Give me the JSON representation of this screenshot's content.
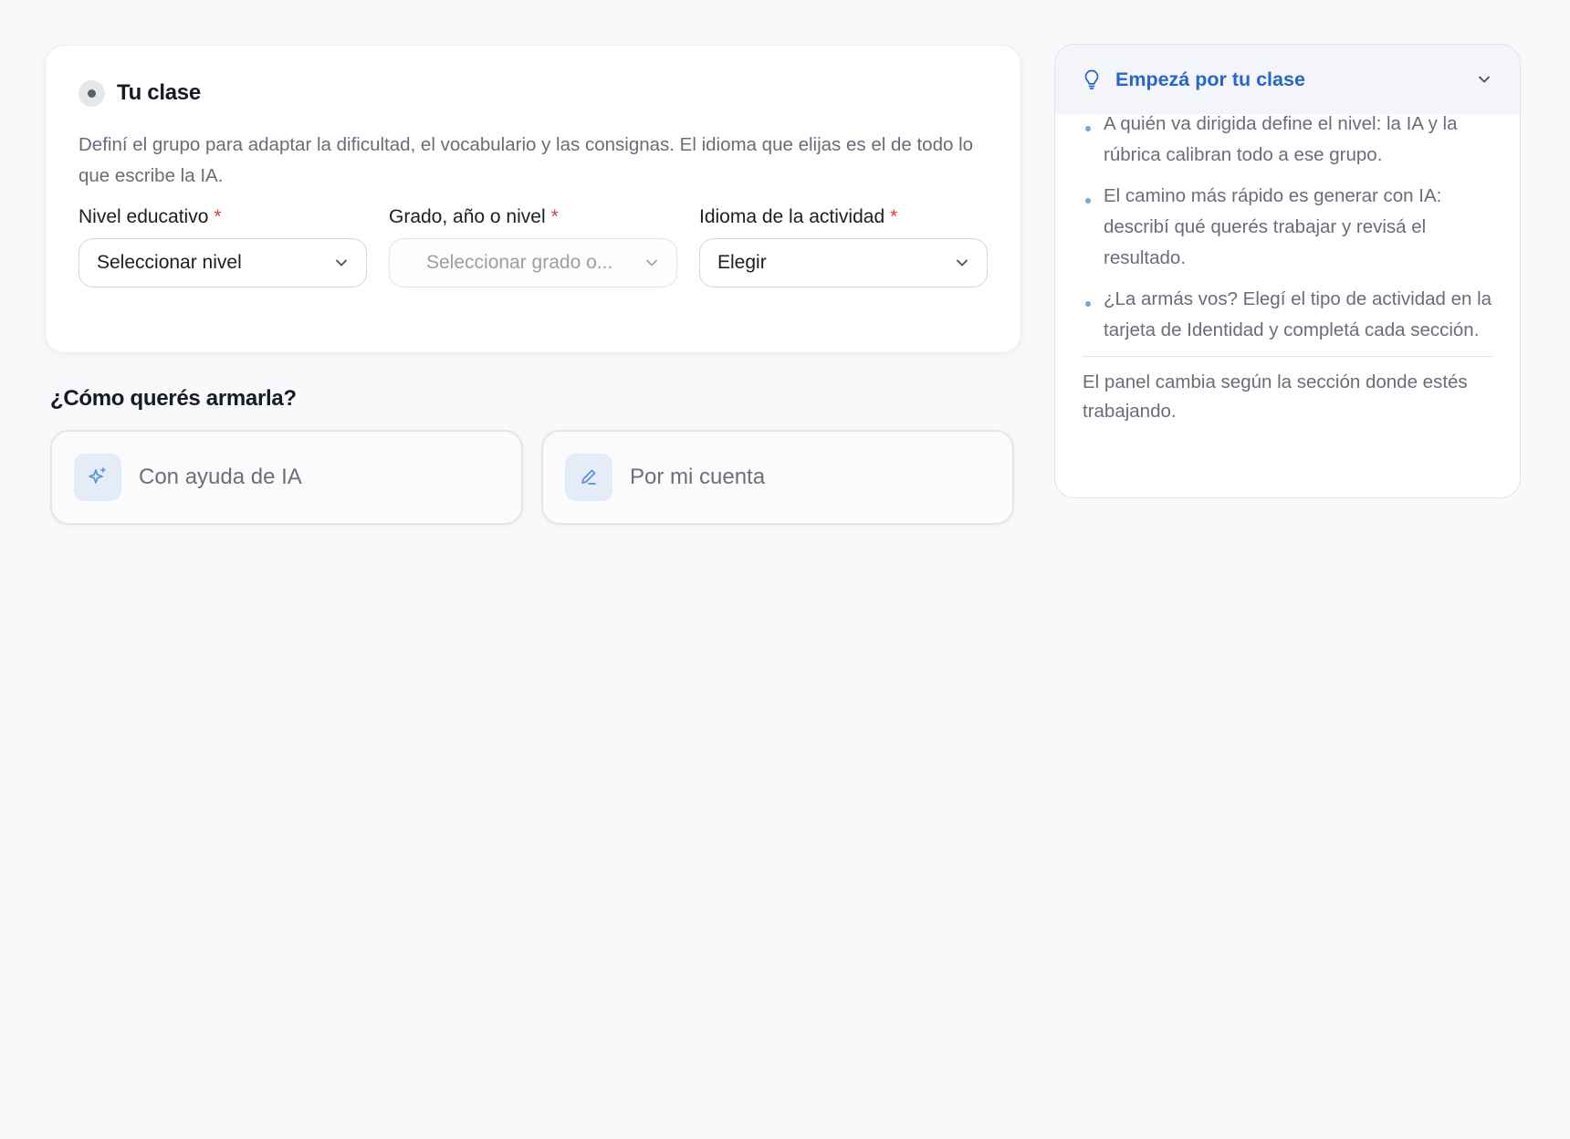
{
  "class_card": {
    "title": "Tu clase",
    "description": "Definí el grupo para adaptar la dificultad, el vocabulario y las consignas. El idioma que elijas es el de todo lo que escribe la IA.",
    "fields": [
      {
        "label": "Nivel educativo",
        "required_mark": "*",
        "value": "Seleccionar nivel",
        "disabled": false
      },
      {
        "label": "Grado, año o nivel",
        "required_mark": "*",
        "value": "Seleccionar grado o...",
        "disabled": true
      },
      {
        "label": "Idioma de la actividad",
        "required_mark": "*",
        "value": "Elegir",
        "disabled": false
      }
    ]
  },
  "build_section": {
    "question": "¿Cómo querés armarla?",
    "options": [
      {
        "label": "Con ayuda de IA",
        "icon": "sparkles-icon"
      },
      {
        "label": "Por mi cuenta",
        "icon": "pencil-icon"
      }
    ]
  },
  "tips_panel": {
    "title": "Empezá por tu clase",
    "icon": "lightbulb-icon",
    "expanded": true,
    "items": [
      "A quién va dirigida define el nivel: la IA y la rúbrica calibran todo a ese grupo.",
      "El camino más rápido es generar con IA: describí qué querés trabajar y revisá el resultado.",
      "¿La armás vos? Elegí el tipo de actividad en la tarjeta de Identidad y completá cada sección."
    ],
    "footer": "El panel cambia según la sección donde estés trabajando."
  },
  "colors": {
    "accent": "#2467c8",
    "required": "#e03a3a",
    "background": "#f8f9fb",
    "icon_tile": "#e4ecf8"
  }
}
